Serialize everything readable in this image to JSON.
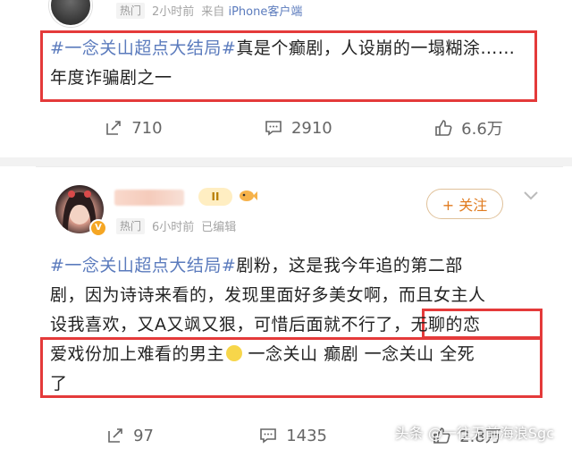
{
  "post1": {
    "hot_badge": "热门",
    "time": "2小时前",
    "source_prefix": "来自",
    "source": "iPhone客户端",
    "hashtag": "#一念关山超点大结局#",
    "text": "真是个癫剧，人设崩的一塌糊涂……年度诈骗剧之一",
    "repost_count": "710",
    "comment_count": "2910",
    "like_count": "6.6万"
  },
  "post2": {
    "level_badge": "II",
    "follow_label": "+ 关注",
    "hot_badge": "热门",
    "time": "6小时前",
    "edited": "已编辑",
    "hashtag": "#一念关山超点大结局#",
    "text_line1_rest": "剧粉，这是我今年追的第二部",
    "text_line2": "剧，因为诗诗来看的，发现里面好多美女啊，而且女主人",
    "text_line3a": "设我喜欢，又A又飒又狠，可惜后面就不行了",
    "text_line3b": "，无聊的恋",
    "text_line4": "爱戏份加上难看的男主",
    "text_line4_tail": " 一念关山 癫剧 一念关山 全死",
    "text_line5": "了",
    "repost_count": "97",
    "comment_count": "1435",
    "like_count": "2.8万"
  },
  "watermark": "头条 @一往无前海浪Sgc",
  "colors": {
    "highlight_red": "#e43a3a",
    "topic_blue": "#5b7bbd",
    "follow_orange": "#e07b1f"
  }
}
